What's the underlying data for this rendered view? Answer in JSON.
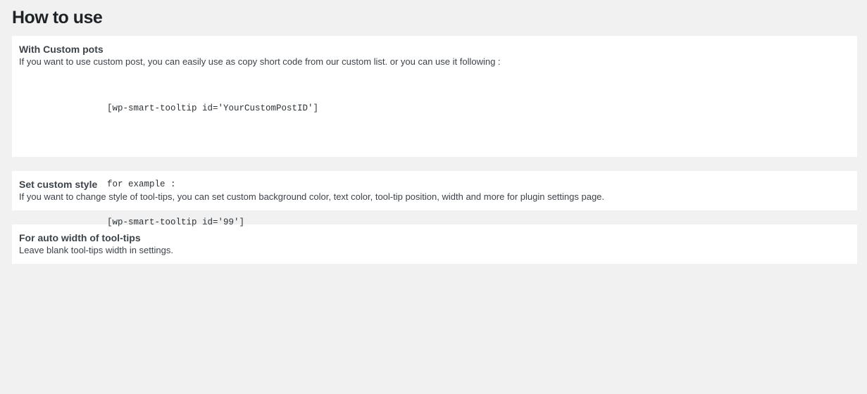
{
  "page": {
    "title": "How to use"
  },
  "sections": [
    {
      "title": "With Custom pots",
      "text": "If you want to use custom post, you can easily use as copy short code from our custom list. or you can use it following :",
      "code": {
        "shortcode": "[wp-smart-tooltip id='YourCustomPostID']",
        "example_label": "for example :",
        "example_code": "[wp-smart-tooltip id='99']"
      }
    },
    {
      "title": "Set custom style",
      "text": "If you want to change style of tool-tips, you can set custom background color, text color, tool-tip position, width and more for plugin settings page."
    },
    {
      "title": "For auto width of tool-tips",
      "text": "Leave blank tool-tips width in settings."
    }
  ]
}
